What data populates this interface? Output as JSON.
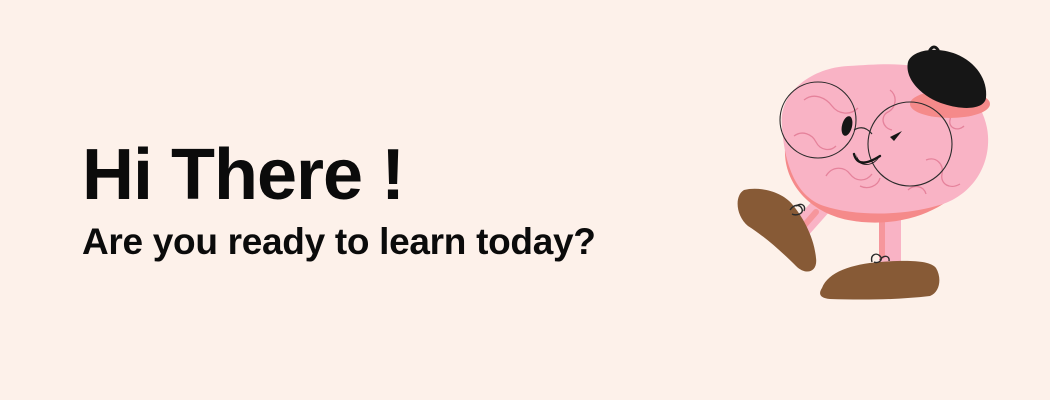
{
  "greeting": {
    "headline": "Hi There !",
    "subheadline": "Are you ready to learn today?"
  },
  "mascot": {
    "icon": "brain-mascot-icon",
    "colors": {
      "brain": "#f9b3c5",
      "brain_shadow": "#f58a8a",
      "beret": "#161616",
      "shoes": "#875a36",
      "outline": "#2b2b2b"
    }
  },
  "theme": {
    "background": "#fdf1ea",
    "text": "#0b0b0b"
  }
}
